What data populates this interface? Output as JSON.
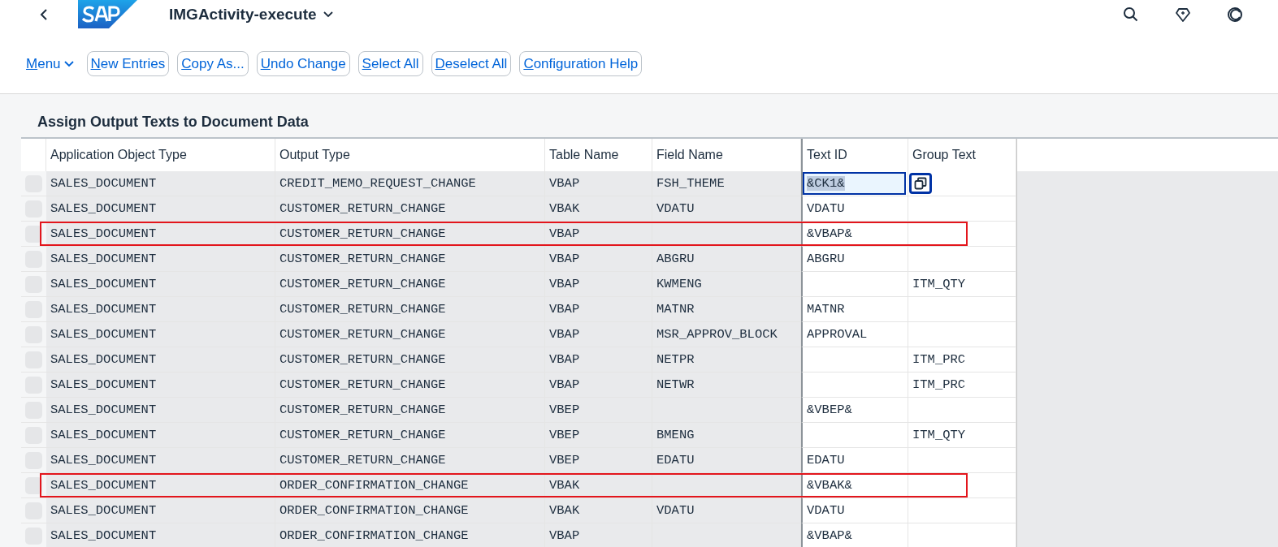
{
  "header": {
    "title": "IMGActivity-execute"
  },
  "toolbar": {
    "menu": "Menu",
    "buttons": [
      "New Entries",
      "Copy As...",
      "Undo Change",
      "Select All",
      "Deselect All",
      "Configuration Help"
    ]
  },
  "table": {
    "title": "Assign Output Texts to Document Data",
    "columns": [
      "Application Object Type",
      "Output Type",
      "Table Name",
      "Field Name",
      "Text ID",
      "Group Text"
    ],
    "rows": [
      {
        "app_type": "SALES_DOCUMENT",
        "output_type": "CREDIT_MEMO_REQUEST_CHANGE",
        "table_name": "VBAP",
        "field_name": "FSH_THEME",
        "text_id": "&CK1&",
        "focused": true,
        "highlighted": false
      },
      {
        "app_type": "SALES_DOCUMENT",
        "output_type": "CUSTOMER_RETURN_CHANGE",
        "table_name": "VBAK",
        "field_name": "VDATU",
        "text_id": "VDATU",
        "focused": false,
        "highlighted": false
      },
      {
        "app_type": "SALES_DOCUMENT",
        "output_type": "CUSTOMER_RETURN_CHANGE",
        "table_name": "VBAP",
        "text_id": "&VBAP&",
        "focused": false,
        "highlighted": true
      },
      {
        "app_type": "SALES_DOCUMENT",
        "output_type": "CUSTOMER_RETURN_CHANGE",
        "table_name": "VBAP",
        "field_name": "ABGRU",
        "text_id": "ABGRU",
        "focused": false,
        "highlighted": false
      },
      {
        "app_type": "SALES_DOCUMENT",
        "output_type": "CUSTOMER_RETURN_CHANGE",
        "table_name": "VBAP",
        "field_name": "KWMENG",
        "group_text": "ITM_QTY",
        "focused": false,
        "highlighted": false
      },
      {
        "app_type": "SALES_DOCUMENT",
        "output_type": "CUSTOMER_RETURN_CHANGE",
        "table_name": "VBAP",
        "field_name": "MATNR",
        "text_id": "MATNR",
        "focused": false,
        "highlighted": false
      },
      {
        "app_type": "SALES_DOCUMENT",
        "output_type": "CUSTOMER_RETURN_CHANGE",
        "table_name": "VBAP",
        "field_name": "MSR_APPROV_BLOCK",
        "text_id": "APPROVAL",
        "focused": false,
        "highlighted": false
      },
      {
        "app_type": "SALES_DOCUMENT",
        "output_type": "CUSTOMER_RETURN_CHANGE",
        "table_name": "VBAP",
        "field_name": "NETPR",
        "group_text": "ITM_PRC",
        "focused": false,
        "highlighted": false
      },
      {
        "app_type": "SALES_DOCUMENT",
        "output_type": "CUSTOMER_RETURN_CHANGE",
        "table_name": "VBAP",
        "field_name": "NETWR",
        "group_text": "ITM_PRC",
        "focused": false,
        "highlighted": false
      },
      {
        "app_type": "SALES_DOCUMENT",
        "output_type": "CUSTOMER_RETURN_CHANGE",
        "table_name": "VBEP",
        "text_id": "&VBEP&",
        "focused": false,
        "highlighted": false
      },
      {
        "app_type": "SALES_DOCUMENT",
        "output_type": "CUSTOMER_RETURN_CHANGE",
        "table_name": "VBEP",
        "field_name": "BMENG",
        "group_text": "ITM_QTY",
        "focused": false,
        "highlighted": false
      },
      {
        "app_type": "SALES_DOCUMENT",
        "output_type": "CUSTOMER_RETURN_CHANGE",
        "table_name": "VBEP",
        "field_name": "EDATU",
        "text_id": "EDATU",
        "focused": false,
        "highlighted": false
      },
      {
        "app_type": "SALES_DOCUMENT",
        "output_type": "ORDER_CONFIRMATION_CHANGE",
        "table_name": "VBAK",
        "text_id": "&VBAK&",
        "focused": false,
        "highlighted": true
      },
      {
        "app_type": "SALES_DOCUMENT",
        "output_type": "ORDER_CONFIRMATION_CHANGE",
        "table_name": "VBAK",
        "field_name": "VDATU",
        "text_id": "VDATU",
        "focused": false,
        "highlighted": false
      },
      {
        "app_type": "SALES_DOCUMENT",
        "output_type": "ORDER_CONFIRMATION_CHANGE",
        "table_name": "VBAP",
        "text_id": "&VBAP&",
        "focused": false,
        "highlighted": false
      }
    ]
  }
}
